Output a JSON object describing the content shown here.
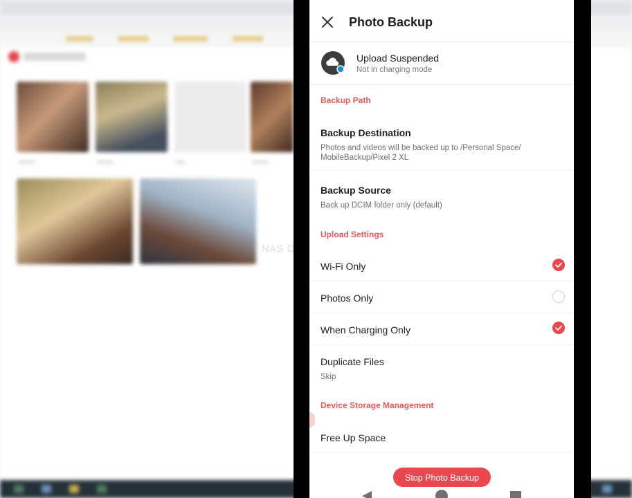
{
  "background": {
    "watermark": "NAS COMPARES"
  },
  "header": {
    "title": "Photo Backup",
    "close_icon": "close-icon"
  },
  "status": {
    "icon": "cloud-upload-icon",
    "title": "Upload Suspended",
    "subtitle": "Not in charging mode"
  },
  "sections": {
    "backup_path": "Backup Path",
    "upload_settings": "Upload Settings",
    "device_storage": "Device Storage Management"
  },
  "backup_destination": {
    "title": "Backup Destination",
    "line1": "Photos and videos will be backed up to /Personal Space/",
    "line2": "MobileBackup/Pixel 2 XL"
  },
  "backup_source": {
    "title": "Backup Source",
    "subtitle": "Back up DCIM folder only (default)"
  },
  "settings": [
    {
      "label": "Wi-Fi Only",
      "checked": true
    },
    {
      "label": "Photos Only",
      "checked": false
    },
    {
      "label": "When Charging Only",
      "checked": true
    }
  ],
  "duplicate_files": {
    "title": "Duplicate Files",
    "value": "Skip"
  },
  "free_up_space": "Free Up Space",
  "stop_button": "Stop Photo Backup",
  "colors": {
    "accent": "#e8484e",
    "section": "#e05a5c"
  }
}
